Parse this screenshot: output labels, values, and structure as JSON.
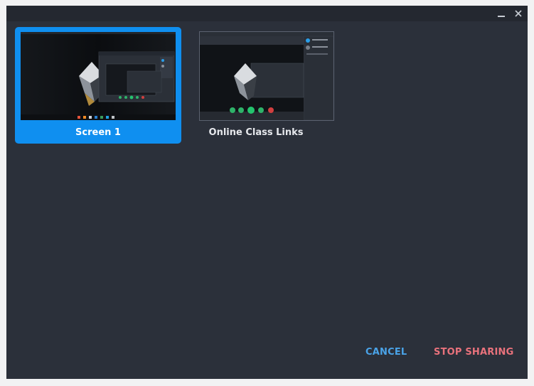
{
  "window": {
    "minimize_icon": "minimize-icon",
    "close_icon": "close-icon"
  },
  "sources": [
    {
      "label": "Screen 1",
      "selected": true
    },
    {
      "label": "Online Class Links",
      "selected": false
    }
  ],
  "footer": {
    "cancel_label": "CANCEL",
    "stop_label": "STOP SHARING"
  },
  "colors": {
    "background": "#2b303a",
    "titlebar": "#242830",
    "selection": "#0f8ff0",
    "cancel": "#4aa3e8",
    "stop": "#e9727c"
  }
}
